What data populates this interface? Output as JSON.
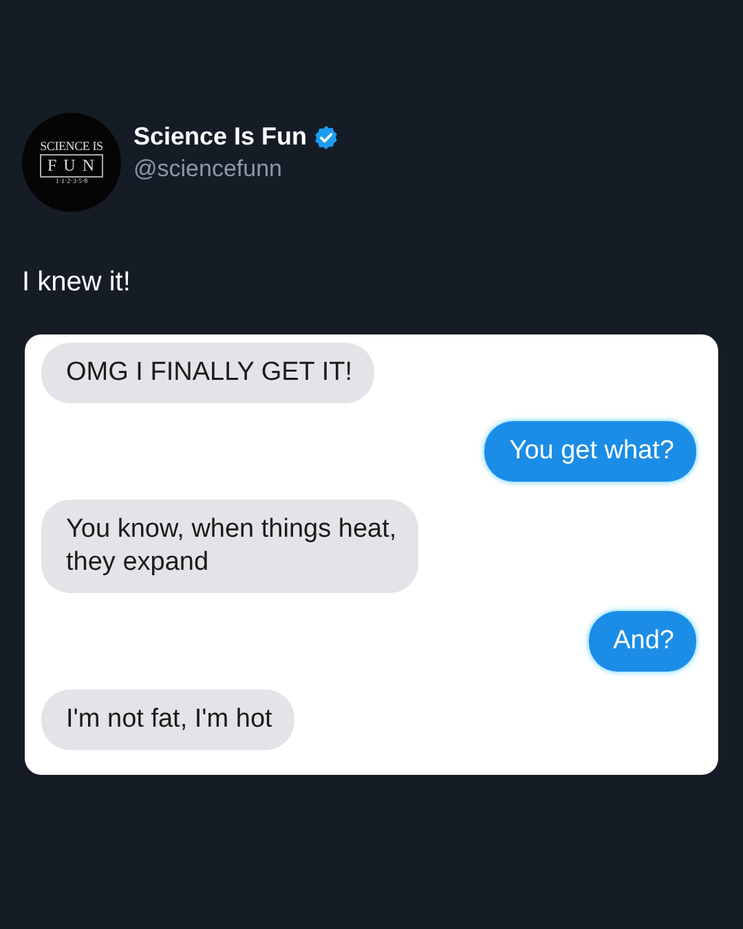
{
  "author": {
    "avatar": {
      "line_1": "SCIENCE IS",
      "line_2": "FUN",
      "line_3": "1·1·2·3·5·8"
    },
    "name": "Science Is Fun",
    "verified": true,
    "handle": "@sciencefunn"
  },
  "post_text": "I knew it!",
  "chat": [
    {
      "kind": "received",
      "text": "OMG I FINALLY GET IT!"
    },
    {
      "kind": "sent",
      "text": "You get what?"
    },
    {
      "kind": "received",
      "text": "You know, when things heat,\nthey expand"
    },
    {
      "kind": "sent",
      "text": "And?"
    },
    {
      "kind": "received",
      "text": "I'm not fat, I'm hot"
    }
  ]
}
